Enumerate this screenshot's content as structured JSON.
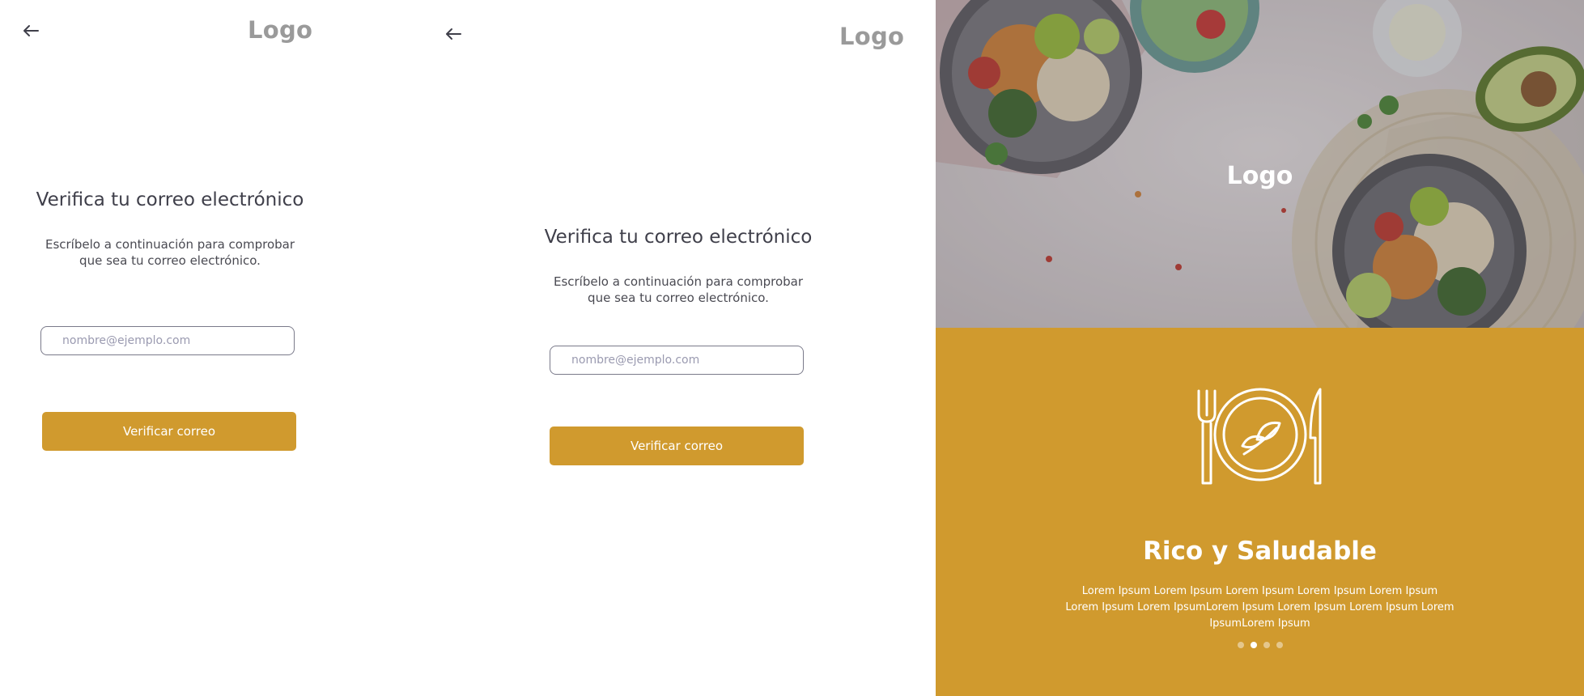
{
  "mobile": {
    "logo": "Logo",
    "heading": "Verifica tu correo electrónico",
    "subtitle_line1": "Escríbelo a continuación para comprobar",
    "subtitle_line2": "que sea tu correo electrónico.",
    "email_placeholder": "nombre@ejemplo.com",
    "verify_button": "Verificar correo",
    "back_icon": "arrow-left-icon"
  },
  "tablet": {
    "logo": "Logo",
    "heading": "Verifica tu correo electrónico",
    "subtitle_line1": "Escríbelo a continuación para comprobar",
    "subtitle_line2": "que sea tu correo electrónico.",
    "email_placeholder": "nombre@ejemplo.com",
    "verify_button": "Verificar correo",
    "back_icon": "arrow-left-icon"
  },
  "hero": {
    "logo": "Logo",
    "illustration_icon": "plate-fork-knife-icon",
    "title": "Rico y Saludable",
    "description": "Lorem Ipsum Lorem Ipsum Lorem Ipsum Lorem Ipsum Lorem Ipsum Lorem Ipsum Lorem IpsumLorem Ipsum Lorem Ipsum Lorem Ipsum Lorem IpsumLorem Ipsum",
    "carousel_active_index": 1,
    "carousel_count": 4
  },
  "colors": {
    "accent": "#d09a2e",
    "text_dark": "#3f3f4a",
    "logo_gray": "#9a9a9a",
    "input_border": "#7a7a8a",
    "white": "#ffffff"
  }
}
